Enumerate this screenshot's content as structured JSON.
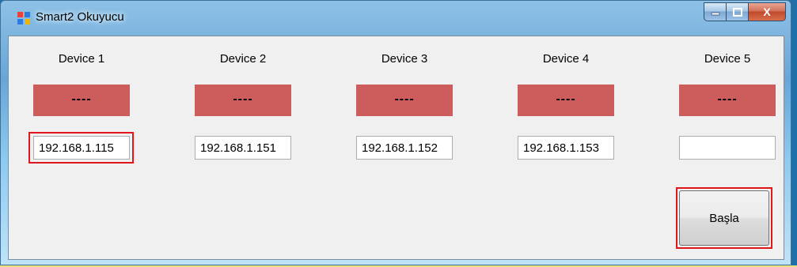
{
  "window": {
    "title": "Smart2 Okuyucu",
    "controls": {
      "minimize": "—",
      "maximize": "□",
      "close": "X"
    }
  },
  "devices": [
    {
      "label": "Device 1",
      "status": "----",
      "ip": "192.168.1.115"
    },
    {
      "label": "Device 2",
      "status": "----",
      "ip": "192.168.1.151"
    },
    {
      "label": "Device 3",
      "status": "----",
      "ip": "192.168.1.152"
    },
    {
      "label": "Device 4",
      "status": "----",
      "ip": "192.168.1.153"
    },
    {
      "label": "Device 5",
      "status": "----",
      "ip": ""
    }
  ],
  "actions": {
    "start_label": "Başla"
  },
  "colors": {
    "status_bg": "#cd5c5c",
    "highlight": "#e0161c"
  }
}
